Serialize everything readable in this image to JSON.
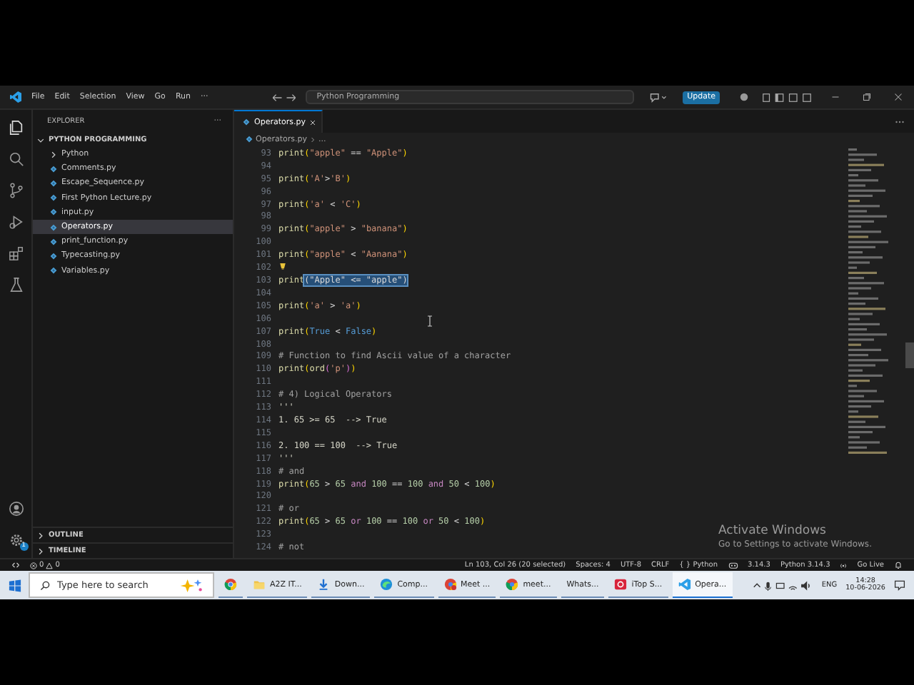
{
  "window": {
    "menu": [
      "File",
      "Edit",
      "Selection",
      "View",
      "Go",
      "Run",
      "···"
    ],
    "search": "Python Programming",
    "update_button": "Update"
  },
  "activity_bar": {
    "settings_badge": "1"
  },
  "explorer": {
    "title": "EXPLORER",
    "more": "···",
    "folder": {
      "label": "PYTHON PROGRAMMING",
      "expanded": true,
      "children": [
        {
          "label": "Python",
          "kind": "folder",
          "selected": false
        },
        {
          "label": "Comments.py",
          "kind": "file",
          "selected": false
        },
        {
          "label": "Escape_Sequence.py",
          "kind": "file",
          "selected": false
        },
        {
          "label": "First Python Lecture.py",
          "kind": "file",
          "selected": false
        },
        {
          "label": "input.py",
          "kind": "file",
          "selected": false
        },
        {
          "label": "Operators.py",
          "kind": "file",
          "selected": true
        },
        {
          "label": "print_function.py",
          "kind": "file",
          "selected": false
        },
        {
          "label": "Typecasting.py",
          "kind": "file",
          "selected": false
        },
        {
          "label": "Variables.py",
          "kind": "file",
          "selected": false
        }
      ]
    },
    "sections": [
      {
        "label": "OUTLINE",
        "expanded": false
      },
      {
        "label": "TIMELINE",
        "expanded": false
      }
    ]
  },
  "tabs": [
    {
      "label": "Operators.py",
      "selected": true
    }
  ],
  "breadcrumb": [
    "Operators.py",
    "..."
  ],
  "editor": {
    "lines": [
      {
        "number": "93",
        "hint": false,
        "tokens": [
          {
            "text": "print",
            "kind": "function"
          },
          {
            "text": "(",
            "kind": "bracket"
          },
          {
            "text": "\"apple\"",
            "kind": "string"
          },
          {
            "text": " == ",
            "kind": "plain"
          },
          {
            "text": "\"Apple\"",
            "kind": "string"
          },
          {
            "text": ")",
            "kind": "bracket"
          }
        ]
      },
      {
        "number": "94",
        "hint": false
      },
      {
        "number": "95",
        "hint": false,
        "tokens": [
          {
            "text": "print",
            "kind": "function"
          },
          {
            "text": "(",
            "kind": "bracket"
          },
          {
            "text": "'A'",
            "kind": "string"
          },
          {
            "text": ">",
            "kind": "plain"
          },
          {
            "text": "'B'",
            "kind": "string"
          },
          {
            "text": ")",
            "kind": "bracket"
          }
        ]
      },
      {
        "number": "96",
        "hint": false
      },
      {
        "number": "97",
        "hint": false,
        "tokens": [
          {
            "text": "print",
            "kind": "function"
          },
          {
            "text": "(",
            "kind": "bracket"
          },
          {
            "text": "'a'",
            "kind": "string"
          },
          {
            "text": " < ",
            "kind": "plain"
          },
          {
            "text": "'C'",
            "kind": "string"
          },
          {
            "text": ")",
            "kind": "bracket"
          }
        ]
      },
      {
        "number": "98",
        "hint": false
      },
      {
        "number": "99",
        "hint": false,
        "tokens": [
          {
            "text": "print",
            "kind": "function"
          },
          {
            "text": "(",
            "kind": "bracket"
          },
          {
            "text": "\"apple\"",
            "kind": "string"
          },
          {
            "text": " > ",
            "kind": "plain"
          },
          {
            "text": "\"banana\"",
            "kind": "string"
          },
          {
            "text": ")",
            "kind": "bracket"
          }
        ]
      },
      {
        "number": "100",
        "hint": false
      },
      {
        "number": "101",
        "hint": false,
        "tokens": [
          {
            "text": "print",
            "kind": "function"
          },
          {
            "text": "(",
            "kind": "bracket"
          },
          {
            "text": "\"apple\"",
            "kind": "string"
          },
          {
            "text": " < ",
            "kind": "plain"
          },
          {
            "text": "\"Aanana\"",
            "kind": "string"
          },
          {
            "text": ")",
            "kind": "bracket"
          }
        ]
      },
      {
        "number": "102",
        "hint": true
      },
      {
        "number": "103",
        "hint": false,
        "tokens": [
          {
            "text": "print",
            "kind": "function"
          },
          {
            "text": "(\"Apple\" <= \"apple\")",
            "kind": "selection"
          }
        ]
      },
      {
        "number": "104",
        "hint": false
      },
      {
        "number": "105",
        "hint": false,
        "tokens": [
          {
            "text": "print",
            "kind": "function"
          },
          {
            "text": "(",
            "kind": "bracket"
          },
          {
            "text": "'a'",
            "kind": "string"
          },
          {
            "text": " > ",
            "kind": "plain"
          },
          {
            "text": "'a'",
            "kind": "string"
          },
          {
            "text": ")",
            "kind": "bracket"
          }
        ]
      },
      {
        "number": "106",
        "hint": false
      },
      {
        "number": "107",
        "hint": false,
        "tokens": [
          {
            "text": "print",
            "kind": "function"
          },
          {
            "text": "(",
            "kind": "bracket"
          },
          {
            "text": "True",
            "kind": "constant"
          },
          {
            "text": " < ",
            "kind": "plain"
          },
          {
            "text": "False",
            "kind": "constant"
          },
          {
            "text": ")",
            "kind": "bracket"
          }
        ]
      },
      {
        "number": "108",
        "hint": false
      },
      {
        "number": "109",
        "hint": false,
        "tokens": [
          {
            "text": "# Function to find Ascii value of a character",
            "kind": "comment"
          }
        ]
      },
      {
        "number": "110",
        "hint": false,
        "tokens": [
          {
            "text": "print",
            "kind": "function"
          },
          {
            "text": "(",
            "kind": "bracket"
          },
          {
            "text": "ord",
            "kind": "function"
          },
          {
            "text": "(",
            "kind": "bracket2"
          },
          {
            "text": "'p'",
            "kind": "string"
          },
          {
            "text": ")",
            "kind": "bracket2"
          },
          {
            "text": ")",
            "kind": "bracket"
          }
        ]
      },
      {
        "number": "111",
        "hint": false
      },
      {
        "number": "112",
        "hint": false,
        "tokens": [
          {
            "text": "# 4) Logical Operators",
            "kind": "comment"
          }
        ]
      },
      {
        "number": "113",
        "hint": false,
        "tokens": [
          {
            "text": "'''",
            "kind": "doc"
          }
        ]
      },
      {
        "number": "114",
        "hint": false,
        "tokens": [
          {
            "text": "1. 65 >= 65  --> True",
            "kind": "doc"
          }
        ]
      },
      {
        "number": "115",
        "hint": false
      },
      {
        "number": "116",
        "hint": false,
        "tokens": [
          {
            "text": "2. 100 == 100  --> True",
            "kind": "doc"
          }
        ]
      },
      {
        "number": "117",
        "hint": false,
        "tokens": [
          {
            "text": "'''",
            "kind": "doc"
          }
        ]
      },
      {
        "number": "118",
        "hint": false,
        "tokens": [
          {
            "text": "# and",
            "kind": "comment"
          }
        ]
      },
      {
        "number": "119",
        "hint": false,
        "tokens": [
          {
            "text": "print",
            "kind": "function"
          },
          {
            "text": "(",
            "kind": "bracket"
          },
          {
            "text": "65",
            "kind": "number"
          },
          {
            "text": " > ",
            "kind": "plain"
          },
          {
            "text": "65",
            "kind": "number"
          },
          {
            "text": " and ",
            "kind": "keyword"
          },
          {
            "text": "100",
            "kind": "number"
          },
          {
            "text": " == ",
            "kind": "plain"
          },
          {
            "text": "100",
            "kind": "number"
          },
          {
            "text": " and ",
            "kind": "keyword"
          },
          {
            "text": "50",
            "kind": "number"
          },
          {
            "text": " < ",
            "kind": "plain"
          },
          {
            "text": "100",
            "kind": "number"
          },
          {
            "text": ")",
            "kind": "bracket"
          }
        ]
      },
      {
        "number": "120",
        "hint": false
      },
      {
        "number": "121",
        "hint": false,
        "tokens": [
          {
            "text": "# or",
            "kind": "comment"
          }
        ]
      },
      {
        "number": "122",
        "hint": false,
        "tokens": [
          {
            "text": "print",
            "kind": "function"
          },
          {
            "text": "(",
            "kind": "bracket"
          },
          {
            "text": "65",
            "kind": "number"
          },
          {
            "text": " > ",
            "kind": "plain"
          },
          {
            "text": "65",
            "kind": "number"
          },
          {
            "text": " or ",
            "kind": "keyword"
          },
          {
            "text": "100",
            "kind": "number"
          },
          {
            "text": " == ",
            "kind": "plain"
          },
          {
            "text": "100",
            "kind": "number"
          },
          {
            "text": " or ",
            "kind": "keyword"
          },
          {
            "text": "50",
            "kind": "number"
          },
          {
            "text": " < ",
            "kind": "plain"
          },
          {
            "text": "100",
            "kind": "number"
          },
          {
            "text": ")",
            "kind": "bracket"
          }
        ]
      },
      {
        "number": "123",
        "hint": false
      },
      {
        "number": "124",
        "hint": false,
        "tokens": [
          {
            "text": "# not",
            "kind": "comment"
          }
        ]
      }
    ]
  },
  "status_bar": {
    "errors": "0",
    "warnings": "0",
    "items": [
      "Ln 103, Col 26 (20 selected)",
      "Spaces: 4",
      "UTF-8",
      "CRLF",
      "{ } Python",
      "3.14.3",
      "Python 3.14.3",
      "Go Live"
    ]
  },
  "activation_notice": {
    "title": "Activate Windows",
    "text": "Go to Settings to activate Windows."
  },
  "taskbar": {
    "search_placeholder": "Type here to search",
    "apps": [
      {
        "selected": false
      },
      {
        "label": "A2Z IT...",
        "selected": false
      },
      {
        "label": "Down...",
        "selected": false
      },
      {
        "label": "Comp...",
        "selected": false
      },
      {
        "label": "Meet ...",
        "selected": false
      },
      {
        "label": "meet...",
        "selected": false
      },
      {
        "label": "Whats...",
        "selected": false
      },
      {
        "label": "iTop S...",
        "selected": false
      },
      {
        "label": "Opera...",
        "selected": true
      }
    ],
    "language": "ENG",
    "time": "14:28",
    "date": "10-06-2026"
  }
}
